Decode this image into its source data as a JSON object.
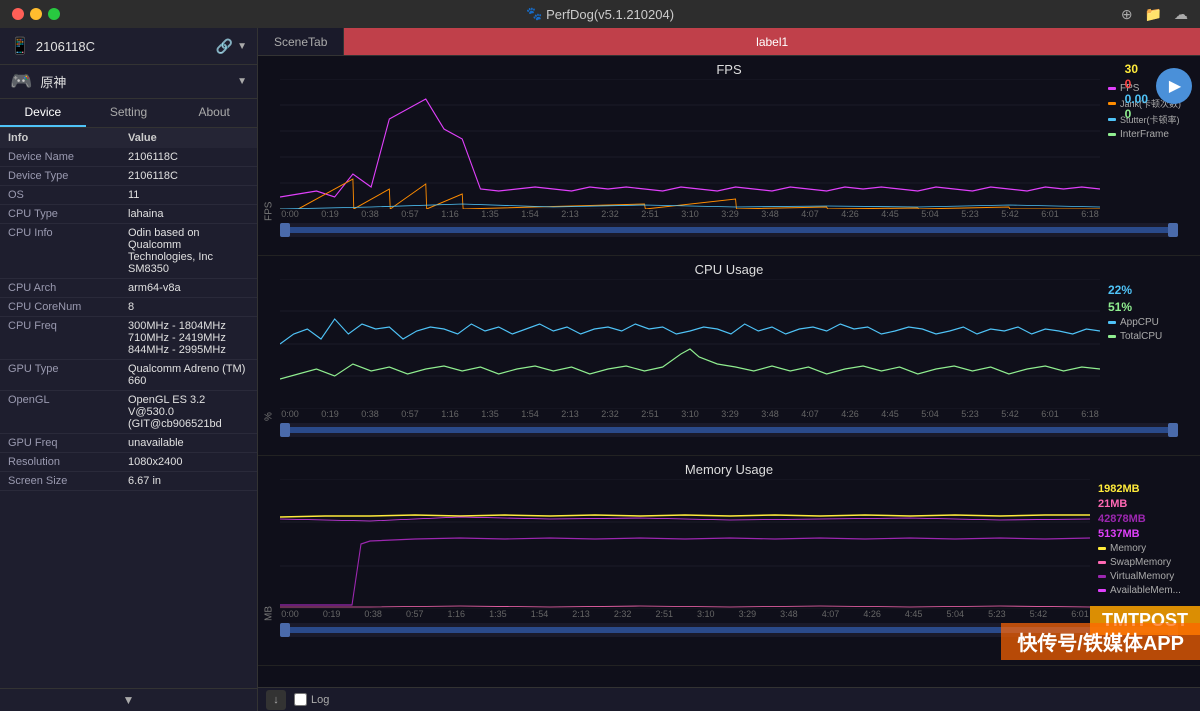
{
  "titlebar": {
    "title": "PerfDog(v5.1.210204)",
    "icon": "🐾"
  },
  "sidebar": {
    "device_name": "2106118C",
    "app_name": "原神",
    "tabs": [
      {
        "id": "device",
        "label": "Device",
        "active": true
      },
      {
        "id": "setting",
        "label": "Setting",
        "active": false
      },
      {
        "id": "about",
        "label": "About",
        "active": false
      }
    ],
    "info_header": {
      "col1": "Info",
      "col2": "Value"
    },
    "info_rows": [
      {
        "label": "Device Name",
        "value": "2106118C"
      },
      {
        "label": "Device Type",
        "value": "2106118C"
      },
      {
        "label": "OS",
        "value": "11"
      },
      {
        "label": "CPU Type",
        "value": "lahaina"
      },
      {
        "label": "CPU Info",
        "value": "Odin based on Qualcomm Technologies, Inc SM8350"
      },
      {
        "label": "CPU Arch",
        "value": "arm64-v8a"
      },
      {
        "label": "CPU CoreNum",
        "value": "8"
      },
      {
        "label": "CPU Freq",
        "value": "300MHz - 1804MHz 710MHz - 2419MHz 844MHz - 2995MHz"
      },
      {
        "label": "GPU Type",
        "value": "Qualcomm Adreno (TM) 660"
      },
      {
        "label": "OpenGL",
        "value": "OpenGL ES 3.2 V@530.0 (GIT@cb906521bd"
      },
      {
        "label": "GPU Freq",
        "value": "unavailable"
      },
      {
        "label": "Resolution",
        "value": "1080x2400"
      },
      {
        "label": "Screen Size",
        "value": "6.67 in"
      }
    ]
  },
  "scene_bar": {
    "tab_label": "SceneTab",
    "label1": "label1"
  },
  "charts": {
    "fps": {
      "title": "FPS",
      "y_label": "FPS",
      "y_max": 125,
      "y_ticks": [
        0,
        25,
        50,
        75,
        100,
        125
      ],
      "x_labels": [
        "0:00",
        "0:19",
        "0:38",
        "0:57",
        "1:16",
        "1:35",
        "1:54",
        "2:13",
        "2:32",
        "2:51",
        "3:10",
        "3:29",
        "3:48",
        "4:07",
        "4:26",
        "4:45",
        "5:04",
        "5:23",
        "5:42",
        "6:01",
        "6:18"
      ],
      "legend": {
        "val1": "30",
        "val2": "0",
        "val3": "0.00",
        "val4": "0",
        "items": [
          {
            "name": "FPS",
            "color": "#e040fb"
          },
          {
            "name": "Jank(卡顿次数)",
            "color": "#ff8c00"
          },
          {
            "name": "Stutter(卡顿率)",
            "color": "#4fc3f7"
          },
          {
            "name": "InterFrame",
            "color": "#90ee90"
          }
        ]
      }
    },
    "cpu": {
      "title": "CPU Usage",
      "y_label": "%",
      "y_max": 100,
      "y_ticks": [
        0,
        25,
        50,
        75,
        100
      ],
      "x_labels": [
        "0:00",
        "0:19",
        "0:38",
        "0:57",
        "1:16",
        "1:35",
        "1:54",
        "2:13",
        "2:32",
        "2:51",
        "3:10",
        "3:29",
        "3:48",
        "4:07",
        "4:26",
        "4:45",
        "5:04",
        "5:23",
        "5:42",
        "6:01",
        "6:18"
      ],
      "legend": [
        {
          "name": "AppCPU",
          "color": "#4fc3f7",
          "value": "22%"
        },
        {
          "name": "TotalCPU",
          "color": "#90ee90",
          "value": "51%"
        }
      ]
    },
    "memory": {
      "title": "Memory Usage",
      "y_label": "MB",
      "y_max": 7500,
      "y_ticks": [
        0,
        2500,
        5000
      ],
      "x_labels": [
        "0:00",
        "0:19",
        "0:38",
        "0:57",
        "1:16",
        "1:35",
        "1:54",
        "2:13",
        "2:32",
        "2:51",
        "3:10",
        "3:29",
        "3:48",
        "4:07",
        "4:26",
        "4:45",
        "5:04",
        "5:23",
        "5:42",
        "6:01"
      ],
      "legend": [
        {
          "name": "Memory",
          "color": "#ffeb3b",
          "value": "1982MB"
        },
        {
          "name": "SwapMemory",
          "color": "#ff69b4",
          "value": "21MB"
        },
        {
          "name": "VirtualMemory",
          "color": "#9c27b0",
          "value": "42878MB"
        },
        {
          "name": "AvailableMem...",
          "color": "#e040fb",
          "value": "5137MB"
        }
      ]
    }
  },
  "bottom_bar": {
    "log_label": "Log"
  }
}
